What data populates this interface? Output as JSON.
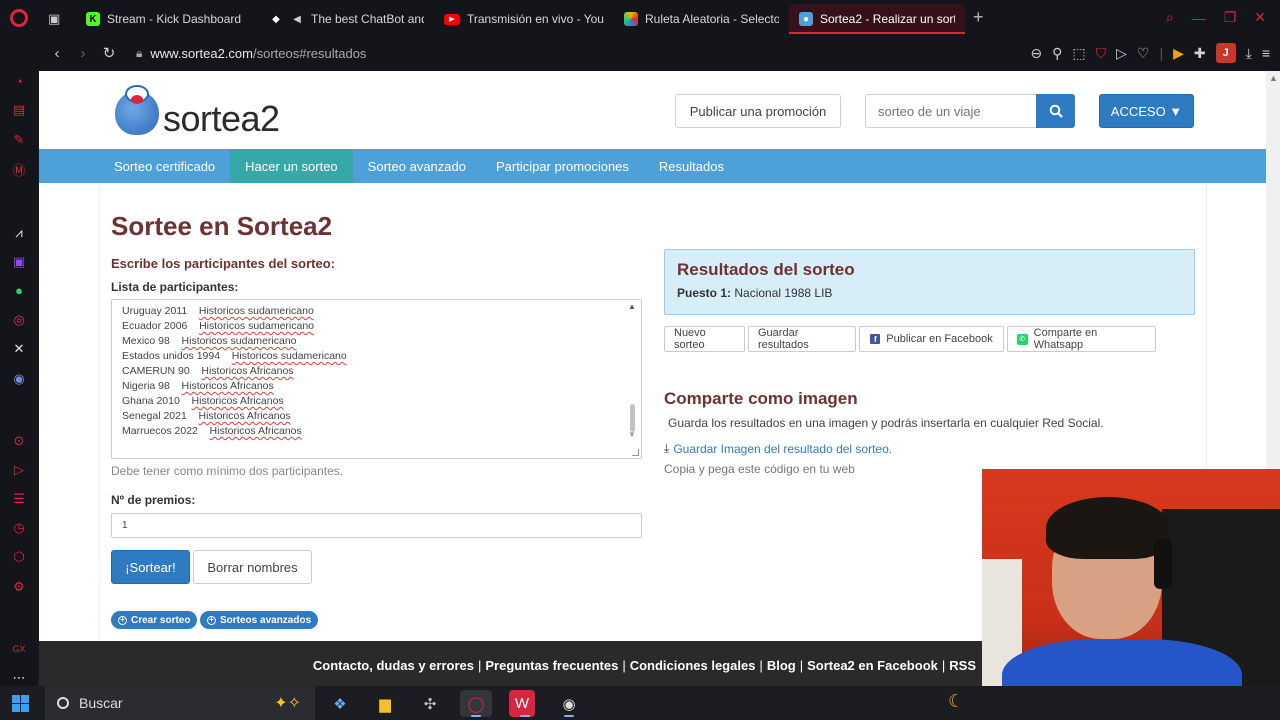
{
  "browser": {
    "tabs": [
      {
        "label": "Stream - Kick Dashboard",
        "icon": "kick-icon",
        "color": "#53fc18",
        "active": false
      },
      {
        "label": "The best ChatBot and",
        "icon": "chatbot-icon",
        "color": "#ffffff",
        "active": false
      },
      {
        "label": "Transmisión en vivo - You",
        "icon": "youtube-icon",
        "color": "#ff0000",
        "active": false
      },
      {
        "label": "Ruleta Aleatoria - Selecto",
        "icon": "wheel-icon",
        "color": "#f4b400",
        "active": false
      },
      {
        "label": "Sortea2 - Realizar un sorte",
        "icon": "sortea2-icon",
        "color": "#4ea0d8",
        "active": true
      }
    ],
    "url_domain": "www.sortea2.com",
    "url_path": "/sorteos#resultados",
    "profile_initial": "J",
    "accent": "#e0243b"
  },
  "site": {
    "logo_text": "sortea2",
    "publish_promo_label": "Publicar una promoción",
    "search_placeholder": "sorteo de un viaje",
    "acceso_label": "ACCESO ▼",
    "nav": [
      {
        "label": "Sorteo certificado"
      },
      {
        "label": "Hacer un sorteo"
      },
      {
        "label": "Sorteo avanzado"
      },
      {
        "label": "Participar promociones"
      },
      {
        "label": "Resultados"
      }
    ],
    "brand_color": "#2f7bc2"
  },
  "form": {
    "title": "Sortee en Sortea2",
    "heading": "Escribe los participantes del sorteo:",
    "list_label": "Lista de participantes:",
    "participants": [
      {
        "name": "Uruguay 2011",
        "tag": "Historicos sudamericano"
      },
      {
        "name": "Ecuador 2006",
        "tag": "Historicos sudamericano"
      },
      {
        "name": "Mexico 98",
        "tag": "Historicos sudamericano"
      },
      {
        "name": "Estados unidos 1994",
        "tag": "Historicos sudamericano"
      },
      {
        "name": "CAMERUN 90",
        "tag": "Historicos Africanos"
      },
      {
        "name": "Nigeria 98",
        "tag": "Historicos Africanos"
      },
      {
        "name": "Ghana 2010",
        "tag": "Historicos Africanos"
      },
      {
        "name": "Senegal 2021",
        "tag": "Historicos Africanos"
      },
      {
        "name": "Marruecos 2022",
        "tag": "Historicos Africanos"
      }
    ],
    "help_text": "Debe tener como mínimo dos participantes.",
    "prizes_label": "Nº de premios:",
    "prizes_value": "1",
    "draw_label": "¡Sortear!",
    "clear_label": "Borrar nombres",
    "create_label": "Crear sorteo",
    "advanced_label": "Sorteos avanzados"
  },
  "results": {
    "title": "Resultados del sorteo",
    "place_label": "Puesto 1:",
    "place_value": "Nacional 1988 LIB",
    "buttons": {
      "new": "Nuevo sorteo",
      "save": "Guardar resultados",
      "facebook": "Publicar en Facebook",
      "whatsapp": "Comparte en Whatsapp"
    }
  },
  "share": {
    "title": "Comparte como imagen",
    "description": "Guarda los resultados en una imagen y podrás insertarla en cualquier Red Social.",
    "save_image_link": "Guardar Imagen del resultado del sorteo.",
    "copy_text": "Copia y pega este código en tu web"
  },
  "footer": {
    "links": [
      "Contacto, dudas y errores",
      "Preguntas frecuentes",
      "Condiciones legales",
      "Blog",
      "Sortea2 en Facebook",
      "RSS"
    ]
  },
  "taskbar": {
    "search_label": "Buscar"
  }
}
